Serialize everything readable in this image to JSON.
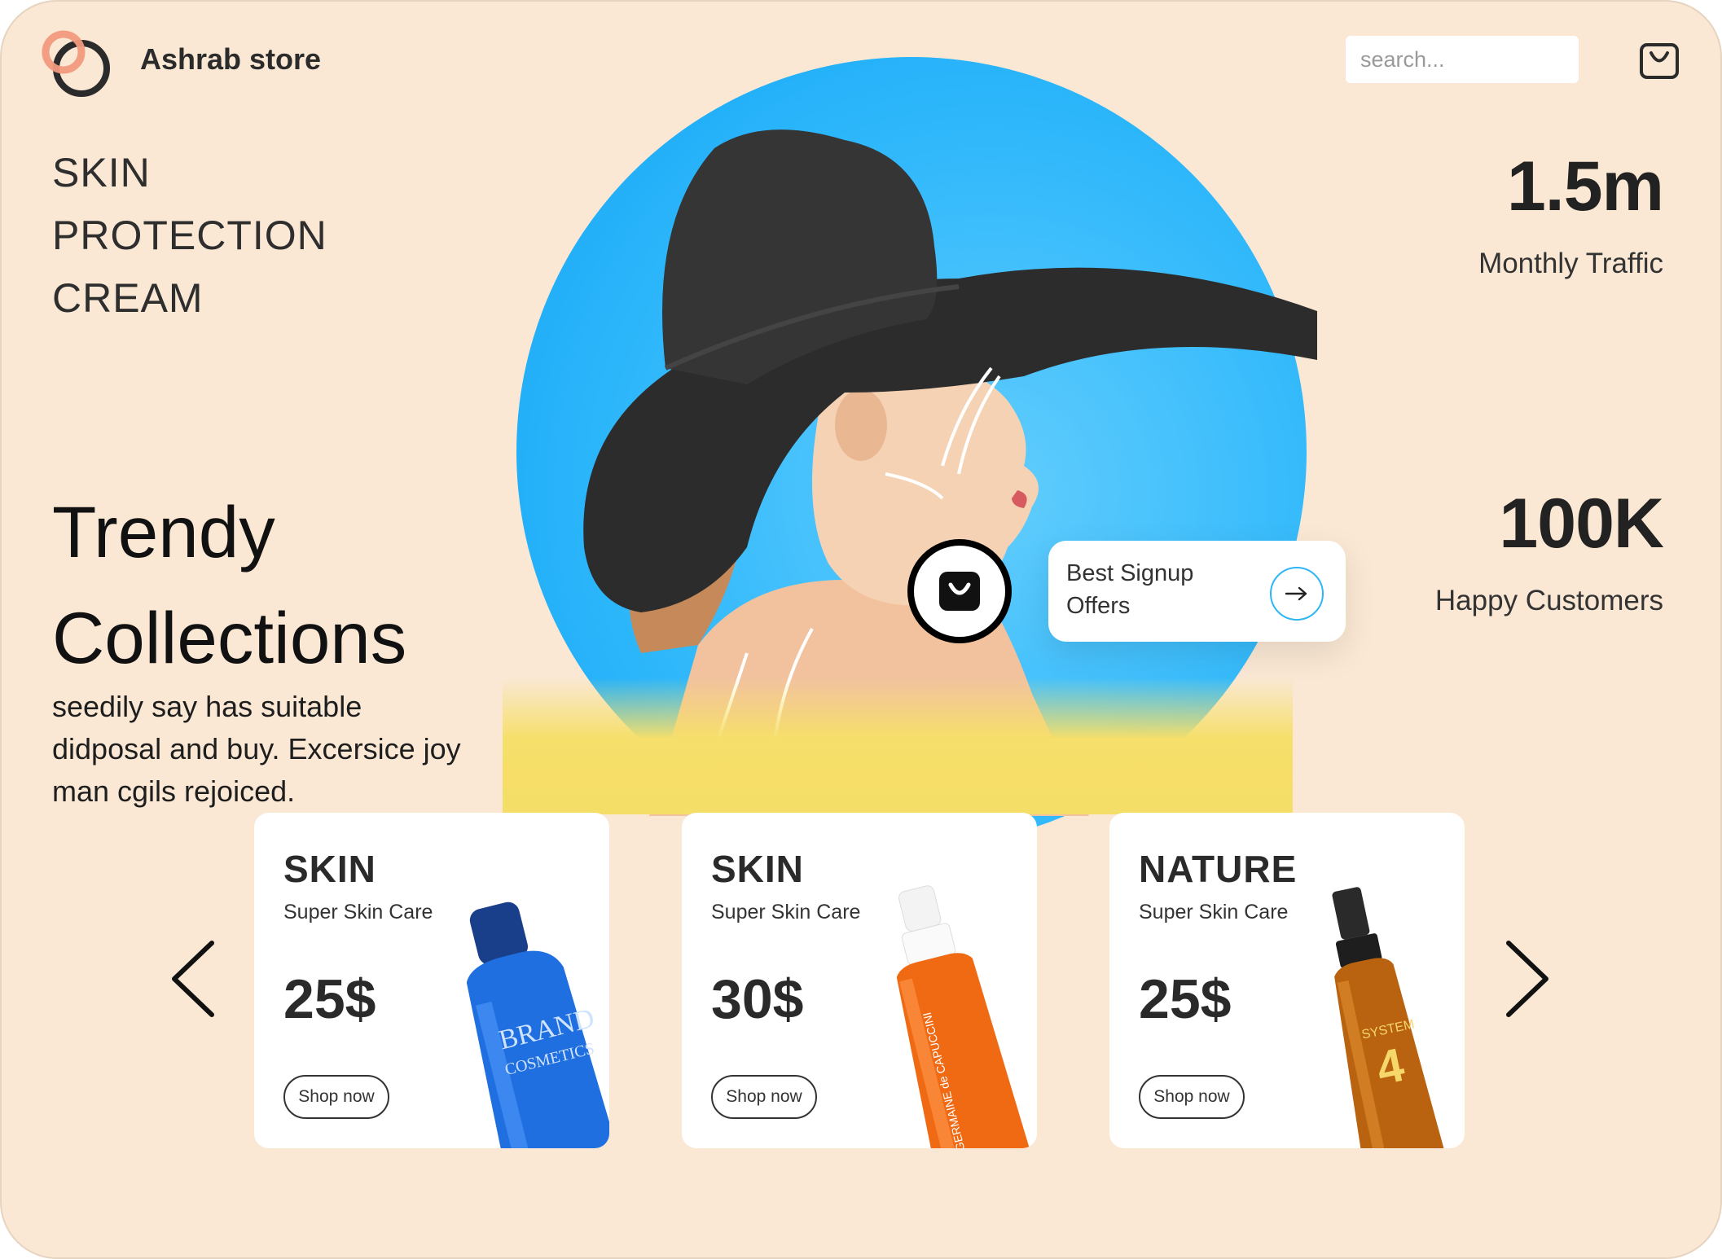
{
  "header": {
    "brand": "Ashrab store",
    "search_placeholder": "search...",
    "cart_icon": "shopping-bag-icon"
  },
  "hero": {
    "tagline": [
      "SKIN",
      "PROTECTION",
      "CREAM"
    ],
    "headline": [
      "Trendy",
      "Collections"
    ],
    "description": "seedily say has suitable didposal and buy. Excersice joy man cgils rejoiced."
  },
  "stats": [
    {
      "value": "1.5m",
      "label": "Monthly Traffic"
    },
    {
      "value": "100K",
      "label": "Happy Customers"
    }
  ],
  "offer": {
    "text": "Best Signup Offers",
    "icon": "arrow-right-icon"
  },
  "products": [
    {
      "title": "SKIN",
      "subtitle": "Super Skin Care",
      "price": "25$",
      "button": "Shop now",
      "bottle_text": [
        "BRAND",
        "COSMETICS"
      ]
    },
    {
      "title": "SKIN",
      "subtitle": "Super Skin Care",
      "price": "30$",
      "button": "Shop now",
      "bottle_text": [
        "GERMAINE de CAPUCCINI"
      ]
    },
    {
      "title": "NATURE",
      "subtitle": "Super Skin Care",
      "price": "25$",
      "button": "Shop now",
      "bottle_text": [
        "SYSTEM",
        "4"
      ]
    }
  ],
  "colors": {
    "page_bg": "#fae8d4",
    "hero_circle": "#30b8fb",
    "hero_band": "#f5de67",
    "logo_accent": "#f29a7e",
    "text_dark": "#222222"
  }
}
